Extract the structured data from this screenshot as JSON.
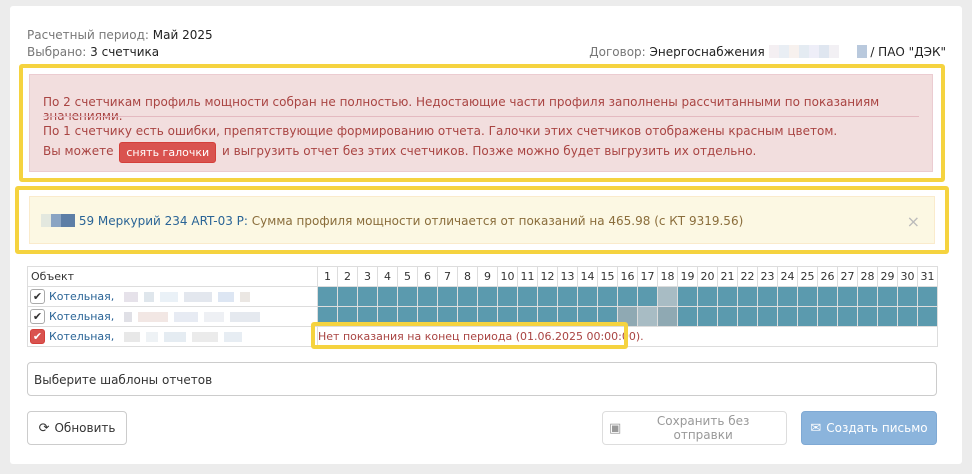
{
  "header": {
    "period_label": "Расчетный период:",
    "period_value": "Май 2025",
    "selected_label": "Выбрано:",
    "selected_value": "3 счетчика",
    "contract_label": "Договор:",
    "contract_value": "Энергоснабжения",
    "contract_org": "/ ПАО \"ДЭК\""
  },
  "alert_danger": {
    "line1": "По 2 счетчикам профиль мощности собран не полностью. Недостающие части профиля заполнены рассчитанными по показаниям значениями.",
    "line2": "По 1 счетчику есть ошибки, препятствующие формированию отчета. Галочки этих счетчиков отображены красным цветом.",
    "line3_before": "Вы можете",
    "uncheck_button": "снять галочки",
    "line3_after": "и выгрузить отчет без этих счетчиков. Позже можно будет выгрузить их отдельно."
  },
  "alert_warning": {
    "link": "59 Меркурий 234 ART-03 P:",
    "text": "Сумма профиля мощности отличается от показаний на 465.98 (с КТ 9319.56)",
    "close": "×"
  },
  "table": {
    "object_header": "Объект",
    "days": [
      "1",
      "2",
      "3",
      "4",
      "5",
      "6",
      "7",
      "8",
      "9",
      "10",
      "11",
      "12",
      "13",
      "14",
      "15",
      "16",
      "17",
      "18",
      "19",
      "20",
      "21",
      "22",
      "23",
      "24",
      "25",
      "26",
      "27",
      "28",
      "29",
      "30",
      "31"
    ],
    "rows": [
      {
        "name": "Котельная,"
      },
      {
        "name": "Котельная,"
      },
      {
        "name": "Котельная,",
        "message": "Нет показания на конец периода (01.06.2025 00:00:00)."
      }
    ]
  },
  "template_select": {
    "placeholder": "Выберите шаблоны отчетов"
  },
  "buttons": {
    "refresh": "Обновить",
    "save": "Сохранить без отправки",
    "create": "Создать письмо"
  },
  "colors": {
    "danger_bg": "#f2dede",
    "danger_text": "#a94442",
    "warning_bg": "#fcf8e3",
    "highlight": "#f5d33f",
    "day_fill": "#5b9aae",
    "primary": "#8bb4dc"
  }
}
